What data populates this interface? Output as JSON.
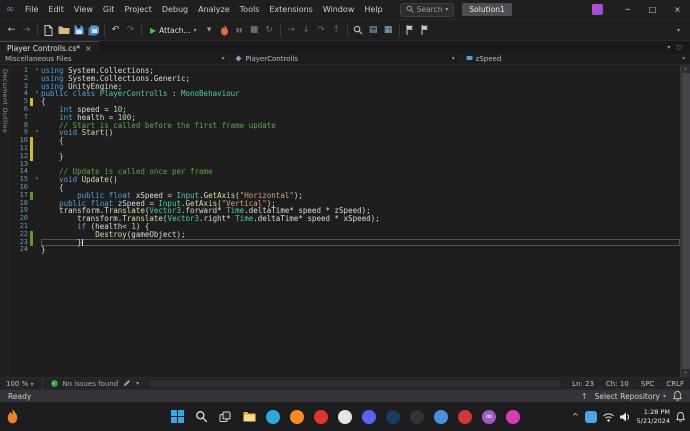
{
  "window": {
    "logo_glyph": "∞",
    "menu": [
      "File",
      "Edit",
      "View",
      "Git",
      "Project",
      "Debug",
      "Analyze",
      "Tools",
      "Extensions",
      "Window",
      "Help"
    ],
    "search_label": "Search",
    "solution": "Solution1",
    "controls": {
      "minimize": "─",
      "maximize": "□",
      "close": "×"
    }
  },
  "toolbar": {
    "attach_label": "Attach...",
    "left_icons": [
      {
        "name": "navigate-backward-icon",
        "glyph": "←",
        "color": "#C8C8C8"
      },
      {
        "name": "navigate-forward-icon",
        "glyph": "→",
        "color": "#7A7A7A"
      },
      {
        "sep": true
      },
      {
        "name": "new-file-icon",
        "icon": "page"
      },
      {
        "name": "open-file-icon",
        "icon": "folder"
      },
      {
        "name": "save-icon",
        "icon": "floppy"
      },
      {
        "name": "save-all-icon",
        "icon": "floppyall"
      },
      {
        "sep": true
      },
      {
        "name": "undo-icon",
        "glyph": "↶",
        "color": "#C8C8C8"
      },
      {
        "name": "redo-icon",
        "glyph": "↷",
        "color": "#6A6A6A"
      },
      {
        "sep": true
      }
    ],
    "right_icons": [
      {
        "name": "debug-target-chevron-icon",
        "glyph": "▾",
        "color": "#9A9A9A"
      },
      {
        "name": "hot-reload-icon",
        "icon": "flame"
      },
      {
        "name": "break-all-icon",
        "glyph": "▮▮",
        "color": "#6A6A6A"
      },
      {
        "name": "stop-icon",
        "glyph": "■",
        "color": "#6A6A6A"
      },
      {
        "name": "restart-icon",
        "glyph": "↻",
        "color": "#6A6A6A"
      },
      {
        "sep": true
      },
      {
        "name": "show-next-statement-icon",
        "glyph": "→",
        "color": "#6A6A6A"
      },
      {
        "name": "step-into-icon",
        "glyph": "↓",
        "color": "#6A6A6A"
      },
      {
        "name": "step-over-icon",
        "glyph": "↷",
        "color": "#6A6A6A"
      },
      {
        "name": "step-out-icon",
        "glyph": "↑",
        "color": "#6A6A6A"
      },
      {
        "sep": true
      },
      {
        "name": "find-in-files-icon",
        "icon": "magnifier"
      },
      {
        "name": "solution-explorer-icon",
        "glyph": "▤",
        "color": "#8FB6D0"
      },
      {
        "name": "properties-window-icon",
        "glyph": "▦",
        "color": "#8FB6D0"
      },
      {
        "sep": true
      },
      {
        "name": "add-bookmark-icon",
        "icon": "flag"
      },
      {
        "name": "bookmark-window-icon",
        "icon": "flag"
      }
    ],
    "overflow_glyph": "▾"
  },
  "tabs": [
    {
      "label": "Player Controlls.cs*",
      "close_glyph": "×"
    }
  ],
  "tabstrip_right": {
    "dropdown_glyph": "▾",
    "float_glyph": "▢"
  },
  "breadcrumb": {
    "crumbs": [
      {
        "label": "Miscellaneous Files"
      },
      {
        "label": "PlayerControlls"
      },
      {
        "label": "zSpeed"
      }
    ],
    "chevron": "▾"
  },
  "editor": {
    "outline_tab": "Document Outline",
    "lines": [
      {
        "n": 1,
        "f": true,
        "t": [
          [
            "kw",
            "using"
          ],
          [
            "pl",
            " System.Collections;"
          ]
        ]
      },
      {
        "n": 2,
        "t": [
          [
            "kw",
            "using"
          ],
          [
            "pl",
            " System.Collections.Generic;"
          ]
        ]
      },
      {
        "n": 3,
        "t": [
          [
            "kw",
            "using"
          ],
          [
            "pl",
            " UnityEngine;"
          ]
        ]
      },
      {
        "n": 4,
        "f": true,
        "t": [
          [
            "kw",
            "public"
          ],
          [
            "pl",
            " "
          ],
          [
            "kw",
            "class"
          ],
          [
            "pl",
            " "
          ],
          [
            "ty",
            "PlayerControlls"
          ],
          [
            "pl",
            " : "
          ],
          [
            "ty",
            "MonoBehaviour"
          ]
        ]
      },
      {
        "n": 5,
        "m": "y",
        "t": [
          [
            "pl",
            "{"
          ]
        ]
      },
      {
        "n": 6,
        "t": [
          [
            "pl",
            "    "
          ],
          [
            "kw",
            "int"
          ],
          [
            "pl",
            " speed = "
          ],
          [
            "nu",
            "10"
          ],
          [
            "pl",
            ";"
          ]
        ]
      },
      {
        "n": 7,
        "t": [
          [
            "pl",
            "    "
          ],
          [
            "kw",
            "int"
          ],
          [
            "pl",
            " health = "
          ],
          [
            "nu",
            "100"
          ],
          [
            "pl",
            ";"
          ]
        ]
      },
      {
        "n": 8,
        "t": [
          [
            "co",
            "    // Start is called before the first frame update"
          ]
        ]
      },
      {
        "n": 9,
        "f": true,
        "t": [
          [
            "pl",
            "    "
          ],
          [
            "kw",
            "void"
          ],
          [
            "pl",
            " "
          ],
          [
            "me",
            "Start"
          ],
          [
            "pl",
            "()"
          ]
        ]
      },
      {
        "n": 10,
        "m": "y",
        "t": [
          [
            "pl",
            "    {"
          ]
        ]
      },
      {
        "n": 11,
        "m": "y",
        "t": []
      },
      {
        "n": 12,
        "m": "y",
        "t": [
          [
            "pl",
            "    }"
          ]
        ]
      },
      {
        "n": 13,
        "t": []
      },
      {
        "n": 14,
        "t": [
          [
            "co",
            "    // Update is called once per frame"
          ]
        ]
      },
      {
        "n": 15,
        "f": true,
        "t": [
          [
            "pl",
            "    "
          ],
          [
            "kw",
            "void"
          ],
          [
            "pl",
            " "
          ],
          [
            "me",
            "Update"
          ],
          [
            "pl",
            "()"
          ]
        ]
      },
      {
        "n": 16,
        "t": [
          [
            "pl",
            "    {"
          ]
        ]
      },
      {
        "n": 17,
        "m": "g",
        "t": [
          [
            "pl",
            "        "
          ],
          [
            "kw",
            "public"
          ],
          [
            "pl",
            " "
          ],
          [
            "kw",
            "float"
          ],
          [
            "pl",
            " xSpeed = "
          ],
          [
            "ty",
            "Input"
          ],
          [
            "pl",
            "."
          ],
          [
            "me",
            "GetAxis"
          ],
          [
            "pl",
            "("
          ],
          [
            "st",
            "\"Horizontal\""
          ],
          [
            "pl",
            ");"
          ]
        ]
      },
      {
        "n": 18,
        "t": [
          [
            "pl",
            "    "
          ],
          [
            "kw",
            "public"
          ],
          [
            "pl",
            " "
          ],
          [
            "kw",
            "float"
          ],
          [
            "pl",
            " zSpeed = "
          ],
          [
            "ty",
            "Input"
          ],
          [
            "pl",
            "."
          ],
          [
            "me",
            "GetAxis"
          ],
          [
            "pl",
            "("
          ],
          [
            "st",
            "\"Vertical\""
          ],
          [
            "pl",
            ");"
          ]
        ]
      },
      {
        "n": 19,
        "t": [
          [
            "pl",
            "    transform."
          ],
          [
            "me",
            "Translate"
          ],
          [
            "pl",
            "("
          ],
          [
            "ty",
            "Vector3"
          ],
          [
            "pl",
            ".forward* "
          ],
          [
            "ty",
            "Time"
          ],
          [
            "pl",
            ".deltaTime* speed * zSpeed);"
          ]
        ]
      },
      {
        "n": 20,
        "t": [
          [
            "pl",
            "        transform."
          ],
          [
            "me",
            "Translate"
          ],
          [
            "pl",
            "("
          ],
          [
            "ty",
            "Vector3"
          ],
          [
            "pl",
            ".right* "
          ],
          [
            "ty",
            "Time"
          ],
          [
            "pl",
            ".deltaTime* speed * xSpeed);"
          ]
        ]
      },
      {
        "n": 21,
        "t": [
          [
            "pl",
            "        "
          ],
          [
            "kw",
            "if"
          ],
          [
            "pl",
            " (health< "
          ],
          [
            "nu",
            "1"
          ],
          [
            "pl",
            ") {"
          ]
        ]
      },
      {
        "n": 22,
        "m": "g",
        "t": [
          [
            "pl",
            "            "
          ],
          [
            "me",
            "Destroy"
          ],
          [
            "pl",
            "(gameObject);"
          ]
        ]
      },
      {
        "n": 23,
        "m": "g",
        "cur": true,
        "caret": true,
        "t": [
          [
            "pl",
            "        }"
          ]
        ]
      },
      {
        "n": 24,
        "t": [
          [
            "pl",
            "}"
          ]
        ]
      }
    ]
  },
  "editor_status": {
    "zoom": "100 %",
    "issues": "No issues found",
    "check_glyph": "✓",
    "line": "Ln: 23",
    "column": "Ch: 10",
    "spaces": "SPC",
    "line_ending": "CRLF"
  },
  "status_bar": {
    "state": "Ready",
    "push_glyph": "↑",
    "repo": "Select Repository",
    "chevron": "▾"
  },
  "taskbar": {
    "apps": [
      {
        "name": "start-button",
        "icon": "windows"
      },
      {
        "name": "taskbar-search-icon",
        "icon": "magnifierw"
      },
      {
        "name": "task-view-icon",
        "icon": "taskview"
      },
      {
        "name": "file-explorer-icon",
        "icon": "explorer"
      },
      {
        "name": "edge-icon",
        "color": "#2FA8E0"
      },
      {
        "name": "firefox-icon",
        "color": "#FF8A2A"
      },
      {
        "name": "opera-icon",
        "color": "#E0342F"
      },
      {
        "name": "brave-icon",
        "color": "#E8E6E3"
      },
      {
        "name": "discord-icon",
        "color": "#5865F2"
      },
      {
        "name": "steam-icon",
        "color": "#1B3A5C"
      },
      {
        "name": "epic-games-icon",
        "color": "#33343A"
      },
      {
        "name": "unity-icon",
        "color": "#4A90D9"
      },
      {
        "name": "riot-client-icon",
        "color": "#D13639"
      },
      {
        "name": "visual-studio-icon",
        "color": "#9B5CC6",
        "glyph": "∞"
      },
      {
        "name": "unity-hub-icon",
        "color": "#D33FB0"
      }
    ],
    "tray_chevron": "^",
    "time": "1:28 PM",
    "date": "5/21/2024"
  },
  "colors": {
    "accent_purple": "#9B6BD3",
    "run_green": "#53B853",
    "issues_green": "#2EA043",
    "modified_yellow": "#D7BA2E",
    "saved_green": "#5B9732"
  }
}
